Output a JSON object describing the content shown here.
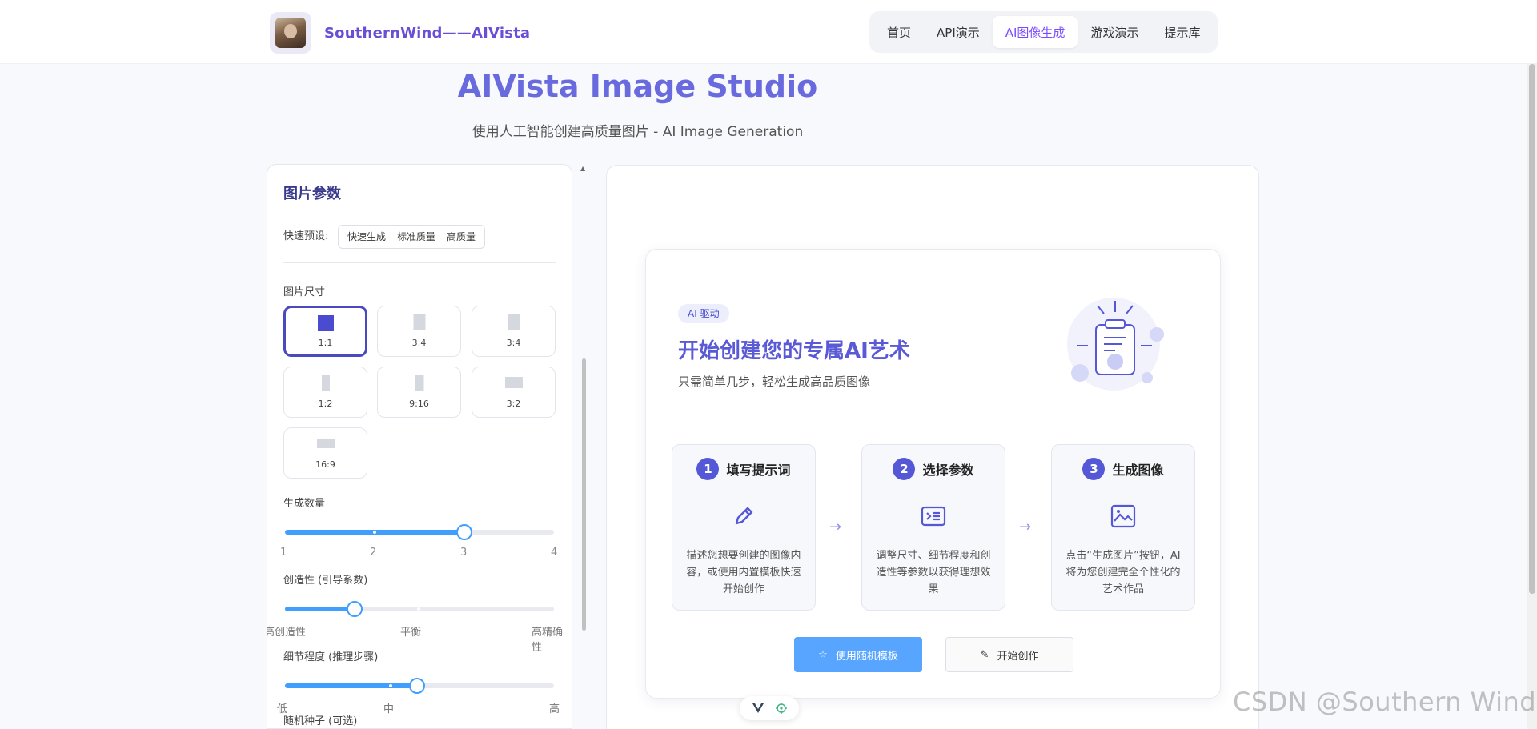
{
  "header": {
    "brand": "SouthernWind——AIVista",
    "nav": [
      {
        "label": "首页",
        "active": false
      },
      {
        "label": "API演示",
        "active": false
      },
      {
        "label": "AI图像生成",
        "active": true
      },
      {
        "label": "游戏演示",
        "active": false
      },
      {
        "label": "提示库",
        "active": false
      }
    ]
  },
  "hero": {
    "title": "AIVista Image Studio",
    "subtitle": "使用人工智能创建高质量图片 - AI Image Generation"
  },
  "params": {
    "title": "图片参数",
    "preset_label": "快速预设:",
    "presets": [
      "快速生成",
      "标准质量",
      "高质量"
    ],
    "size_label": "图片尺寸",
    "sizes": [
      {
        "label": "1:1",
        "selected": true
      },
      {
        "label": "3:4",
        "selected": false
      },
      {
        "label": "3:4",
        "selected": false
      },
      {
        "label": "1:2",
        "selected": false
      },
      {
        "label": "9:16",
        "selected": false
      },
      {
        "label": "3:2",
        "selected": false
      },
      {
        "label": "16:9",
        "selected": false
      }
    ],
    "count": {
      "label": "生成数量",
      "value": 3,
      "ticks": [
        "1",
        "2",
        "3",
        "4"
      ]
    },
    "creativity": {
      "label": "创造性 (引导系数)",
      "value_fraction": 0.26,
      "ticks": [
        "高创造性",
        "平衡",
        "高精确性"
      ]
    },
    "detail": {
      "label": "细节程度 (推理步骤)",
      "value_fraction": 0.49,
      "ticks": [
        "低",
        "中",
        "高"
      ]
    },
    "seed_label": "随机种子 (可选)"
  },
  "welcome": {
    "badge": "AI 驱动",
    "title": "开始创建您的专属AI艺术",
    "subtitle": "只需简单几步，轻松生成高品质图像",
    "steps": [
      {
        "num": "1",
        "title": "填写提示词",
        "icon": "pencil-icon",
        "desc": "描述您想要创建的图像内容，或使用内置模板快速开始创作"
      },
      {
        "num": "2",
        "title": "选择参数",
        "icon": "terminal-icon",
        "desc": "调整尺寸、细节程度和创造性等参数以获得理想效果"
      },
      {
        "num": "3",
        "title": "生成图像",
        "icon": "picture-icon",
        "desc": "点击“生成图片”按钮，AI将为您创建完全个性化的艺术作品"
      }
    ],
    "random_button": "使用随机模板",
    "start_button": "开始创作"
  },
  "colors": {
    "accent": "#5558d6",
    "primary_button": "#57a5ff",
    "slider": "#409eff",
    "active_nav": "#7c4dff"
  },
  "watermark": "CSDN @Southern Wind"
}
